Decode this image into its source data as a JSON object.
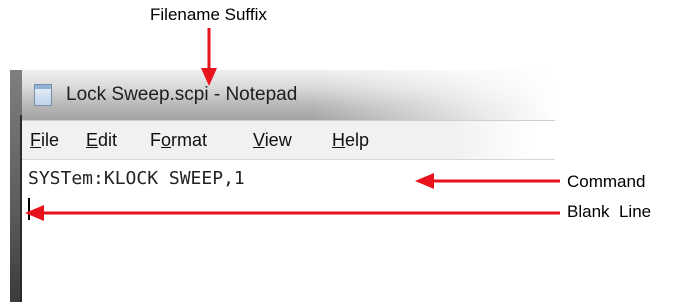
{
  "annotations": {
    "filename_suffix": "Filename Suffix",
    "command": "Command",
    "blank_line": "Blank  Line",
    "arrow_color": "#e8121c"
  },
  "window": {
    "title": "Lock Sweep.scpi - Notepad",
    "app_icon": "notepad-icon"
  },
  "menubar": {
    "items": [
      {
        "mnemonic": "F",
        "rest": "ile"
      },
      {
        "mnemonic": "E",
        "rest": "dit"
      },
      {
        "pre": "F",
        "mnemonic": "o",
        "rest": "rmat"
      },
      {
        "mnemonic": "V",
        "rest": "iew"
      },
      {
        "mnemonic": "H",
        "rest": "elp"
      }
    ]
  },
  "editor": {
    "line1": "SYSTem:KLOCK SWEEP,1",
    "line2": ""
  }
}
